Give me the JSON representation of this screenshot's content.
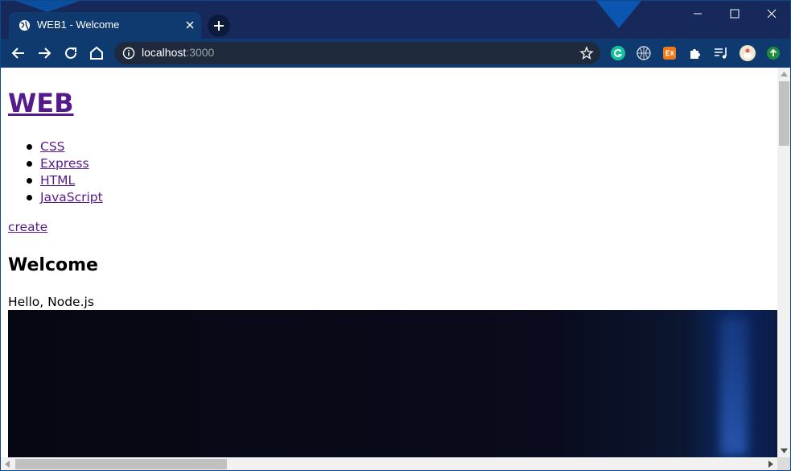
{
  "browser": {
    "tab": {
      "title": "WEB1 - Welcome"
    },
    "address": {
      "host": "localhost",
      "port": ":3000"
    },
    "colors": {
      "frame": "#17295a",
      "toolbar": "#0f3a70",
      "omnibox": "#1f2b3c",
      "link_visited": "#551a8b"
    },
    "icons": {
      "favicon": "globe-icon",
      "close": "close-icon",
      "new_tab": "plus-icon",
      "back": "arrow-left-icon",
      "forward": "arrow-right-icon",
      "reload": "reload-icon",
      "home": "home-icon",
      "site_info": "info-icon",
      "bookmark": "star-icon",
      "extensions": [
        "grammarly-icon",
        "translate-globe-icon",
        "ex-icon",
        "puzzle-icon",
        "reading-list-icon",
        "avatar-icon",
        "update-icon"
      ]
    }
  },
  "page": {
    "title": "WEB",
    "nav": [
      "CSS",
      "Express",
      "HTML",
      "JavaScript"
    ],
    "create": "create",
    "heading": "Welcome",
    "description": "Hello, Node.js"
  }
}
